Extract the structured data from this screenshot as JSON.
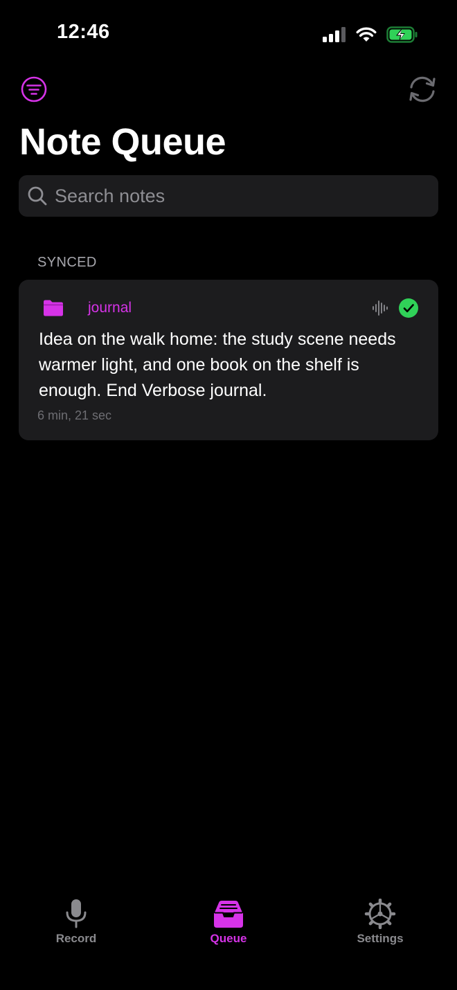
{
  "status_bar": {
    "time": "12:46"
  },
  "header": {
    "title": "Note Queue"
  },
  "search": {
    "placeholder": "Search notes",
    "value": ""
  },
  "sections": [
    {
      "header": "SYNCED",
      "notes": [
        {
          "folder": "journal",
          "text": "Idea on the walk home: the study scene needs warmer light, and one book on the shelf is enough. End Verbose journal.",
          "duration": "6 min, 21 sec",
          "status": "synced"
        }
      ]
    }
  ],
  "tab_bar": {
    "tabs": [
      {
        "label": "Record",
        "icon": "microphone-icon",
        "active": false
      },
      {
        "label": "Queue",
        "icon": "inbox-tray-icon",
        "active": true
      },
      {
        "label": "Settings",
        "icon": "gear-icon",
        "active": false
      }
    ]
  },
  "colors": {
    "accent": "#d633e8",
    "success": "#30d158",
    "background": "#000000",
    "card": "#1c1c1e",
    "secondary_text": "#8e8e93"
  }
}
